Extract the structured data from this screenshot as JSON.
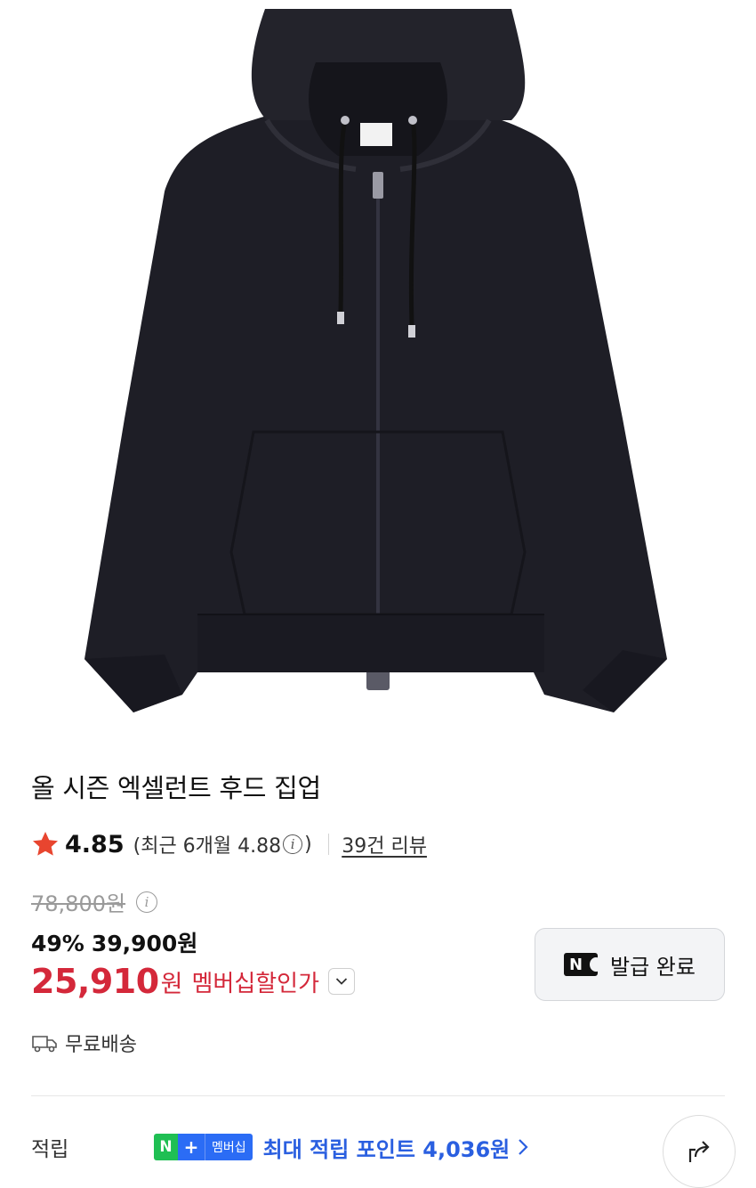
{
  "product": {
    "title": "올 시즌 엑셀런트 후드 집업",
    "image_alt": "black zip-up hoodie product photo"
  },
  "rating": {
    "score": "4.85",
    "recent_prefix": "(최근 6개월 4.88",
    "recent_suffix": ")",
    "info_icon": "i",
    "review_link": "39건 리뷰"
  },
  "price": {
    "original": "78,800원",
    "original_info_icon": "i",
    "discount_percent": "49%",
    "sale_price": "39,900원",
    "member_price": "25,910",
    "member_currency": "원",
    "member_label": "멤버십할인가"
  },
  "coupon": {
    "badge": "N",
    "label": "발급 완료"
  },
  "shipping": {
    "label": "무료배송"
  },
  "points": {
    "label": "적립",
    "badge_n": "N",
    "badge_plus": "+",
    "badge_member": "멤버십",
    "text": "최대 적립 포인트 4,036원"
  },
  "colors": {
    "accent_red": "#d4283a",
    "points_blue": "#2a5fe0",
    "naver_green": "#1fbf53",
    "star_color": "#e8452f"
  },
  "icons": {
    "star": "star-icon",
    "info": "info-icon",
    "chevron_down": "chevron-down-icon",
    "truck": "truck-icon",
    "chevron_right": "chevron-right-icon",
    "share": "share-icon"
  }
}
